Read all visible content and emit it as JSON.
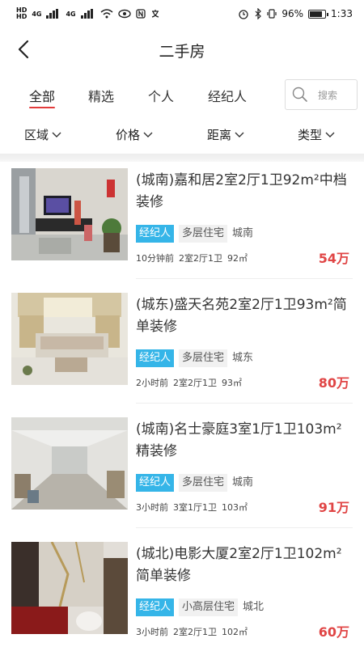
{
  "status_bar": {
    "left_network_labels": [
      "HD",
      "4G",
      "4G"
    ],
    "battery": "96%",
    "time": "1:33"
  },
  "header": {
    "title": "二手房",
    "back_icon": "chevron-left-icon"
  },
  "tabs": [
    {
      "label": "全部",
      "active": true
    },
    {
      "label": "精选",
      "active": false
    },
    {
      "label": "个人",
      "active": false
    },
    {
      "label": "经纪人",
      "active": false
    }
  ],
  "search": {
    "placeholder": "搜索",
    "icon": "search-icon"
  },
  "filters": [
    {
      "label": "区域"
    },
    {
      "label": "价格"
    },
    {
      "label": "距离"
    },
    {
      "label": "类型"
    }
  ],
  "listings": [
    {
      "title": "(城南)嘉和居2室2厅1卫92m²中档装修",
      "tags": [
        "经纪人",
        "多层住宅",
        "城南"
      ],
      "time": "10分钟前",
      "layout": "2室2厅1卫",
      "area": "92㎡",
      "price": "54万"
    },
    {
      "title": "(城东)盛天名苑2室2厅1卫93m²简单装修",
      "tags": [
        "经纪人",
        "多层住宅",
        "城东"
      ],
      "time": "2小时前",
      "layout": "2室2厅1卫",
      "area": "93㎡",
      "price": "80万"
    },
    {
      "title": "(城南)名士豪庭3室1厅1卫103m²精装修",
      "tags": [
        "经纪人",
        "多层住宅",
        "城南"
      ],
      "time": "3小时前",
      "layout": "3室1厅1卫",
      "area": "103㎡",
      "price": "91万"
    },
    {
      "title": "(城北)电影大厦2室2厅1卫102m²简单装修",
      "tags": [
        "经纪人",
        "小高层住宅",
        "城北"
      ],
      "time": "3小时前",
      "layout": "2室2厅1卫",
      "area": "102㎡",
      "price": "60万"
    }
  ],
  "colors": {
    "accent_red": "#e23b3b",
    "price_red": "#e04545",
    "tag_blue": "#35b5e8"
  }
}
